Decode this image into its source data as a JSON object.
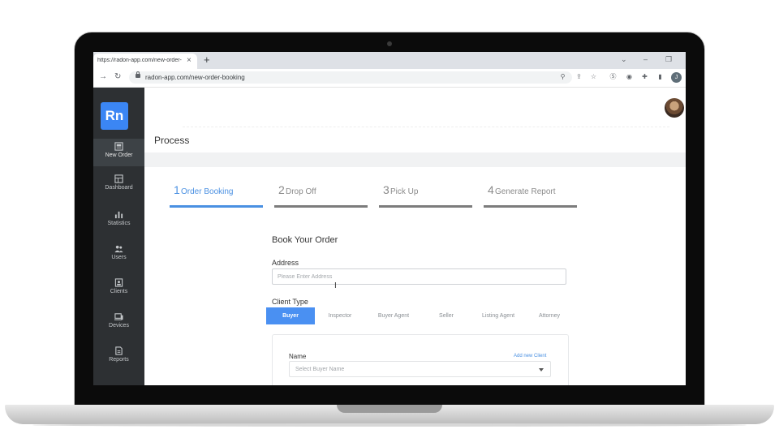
{
  "browser": {
    "tab_title": "https://radon-app.com/new-order-booking",
    "tab_close": "×",
    "new_tab": "+",
    "url": "radon-app.com/new-order-booking",
    "profile_initial": "J"
  },
  "app": {
    "logo": "Rn",
    "page_title": "Process",
    "sidebar": [
      {
        "label": "New Order",
        "icon": "new-order-icon"
      },
      {
        "label": "Dashboard",
        "icon": "dashboard-icon"
      },
      {
        "label": "Statistics",
        "icon": "bar-chart-icon"
      },
      {
        "label": "Users",
        "icon": "users-icon"
      },
      {
        "label": "Clients",
        "icon": "clients-icon"
      },
      {
        "label": "Devices",
        "icon": "devices-icon"
      },
      {
        "label": "Reports",
        "icon": "reports-icon"
      }
    ],
    "steps": [
      {
        "num": "1",
        "label": "Order Booking"
      },
      {
        "num": "2",
        "label": "Drop Off"
      },
      {
        "num": "3",
        "label": "Pick Up"
      },
      {
        "num": "4",
        "label": "Generate Report"
      }
    ],
    "form": {
      "title": "Book Your Order",
      "address_label": "Address",
      "address_placeholder": "Please Enter Address",
      "client_type_label": "Client Type",
      "client_types": [
        "Buyer",
        "Inspector",
        "Buyer Agent",
        "Seller",
        "Listing Agent",
        "Attorney"
      ],
      "name_label": "Name",
      "add_client": "Add new Client",
      "name_placeholder": "Select Buyer Name"
    }
  },
  "colors": {
    "accent": "#4a90f2",
    "sidebar_bg": "#2d3033",
    "logo_bg": "#3b86f4"
  }
}
